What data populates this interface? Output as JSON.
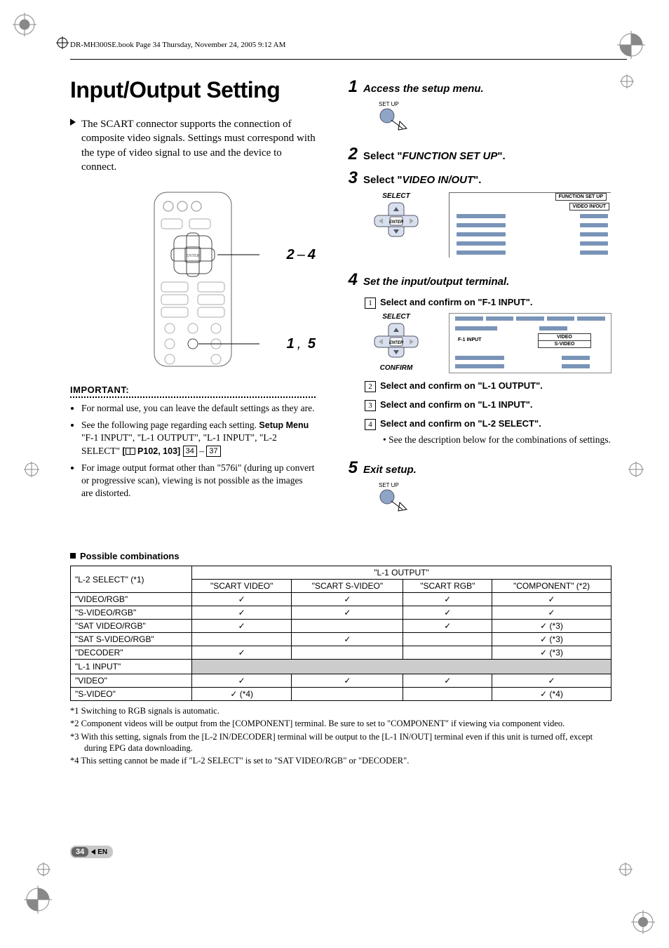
{
  "header": {
    "text": "DR-MH300SE.book  Page 34  Thursday, November 24, 2005  9:12 AM"
  },
  "title": "Input/Output Setting",
  "intro": "The SCART connector supports the connection of composite video signals. Settings must correspond with the type of video signal to use and the device to connect.",
  "remote_labels": {
    "group1": [
      "2",
      "4"
    ],
    "group2": [
      "1",
      "5"
    ]
  },
  "important": {
    "heading": "IMPORTANT:",
    "items": [
      {
        "text": "For normal use, you can leave the default settings as they are."
      },
      {
        "pre": "See the following page regarding each setting. ",
        "setup_menu": "Setup Menu",
        "menu_items": "\"F-1 INPUT\", \"L-1 OUTPUT\", \"L-1 INPUT\", \"L-2 SELECT\"",
        "pages": "P102, 103",
        "refs": [
          "34",
          "37"
        ]
      },
      {
        "text": "For image output format other than \"576i\" (during up convert or progressive scan), viewing is not possible as the images are distorted."
      }
    ]
  },
  "steps": {
    "s1": {
      "num": "1",
      "title": "Access the setup menu.",
      "btn_label": "SET UP"
    },
    "s2": {
      "num": "2",
      "pre": "Select \"",
      "bold": "FUNCTION SET UP",
      "post": "\"."
    },
    "s3": {
      "num": "3",
      "pre": "Select \"",
      "bold": "VIDEO IN/OUT",
      "post": "\"."
    },
    "select_graphic": {
      "select_label": "SELECT",
      "enter_label": "ENTER",
      "menu_tab_top": "FUNCTION SET UP",
      "menu_tab_sub": "VIDEO IN/OUT"
    },
    "s4": {
      "num": "4",
      "title": "Set the input/output terminal.",
      "sub1": {
        "n": "1",
        "text": "Select and confirm on \"F-1 INPUT\"."
      },
      "f1_graphic": {
        "select_label": "SELECT",
        "confirm_label": "CONFIRM",
        "f1_label": "F-1 INPUT",
        "opt1": "VIDEO",
        "opt2": "S-VIDEO"
      },
      "sub2": {
        "n": "2",
        "text": "Select and confirm on \"L-1 OUTPUT\"."
      },
      "sub3": {
        "n": "3",
        "text": "Select and confirm on \"L-1 INPUT\"."
      },
      "sub4": {
        "n": "4",
        "text": "Select and confirm on \"L-2 SELECT\"."
      },
      "sub4_desc": "See the description below for the combinations of settings."
    },
    "s5": {
      "num": "5",
      "title": "Exit setup.",
      "btn_label": "SET UP"
    }
  },
  "combinations": {
    "heading": "Possible combinations",
    "col_group": "\"L-1 OUTPUT\"",
    "row_group": "\"L-2 SELECT\" (*1)",
    "cols": [
      "\"SCART VIDEO\"",
      "\"SCART S-VIDEO\"",
      "\"SCART RGB\"",
      "\"COMPONENT\" (*2)"
    ],
    "rows": [
      {
        "label": "\"VIDEO/RGB\"",
        "cells": [
          "✓",
          "✓",
          "✓",
          "✓"
        ]
      },
      {
        "label": "\"S-VIDEO/RGB\"",
        "cells": [
          "✓",
          "✓",
          "✓",
          "✓"
        ]
      },
      {
        "label": "\"SAT VIDEO/RGB\"",
        "cells": [
          "✓",
          "",
          "✓",
          "✓ (*3)"
        ]
      },
      {
        "label": "\"SAT S-VIDEO/RGB\"",
        "cells": [
          "",
          "✓",
          "",
          "✓ (*3)"
        ]
      },
      {
        "label": "\"DECODER\"",
        "cells": [
          "✓",
          "",
          "",
          "✓ (*3)"
        ]
      }
    ],
    "section2_label": "\"L-1 INPUT\"",
    "rows2": [
      {
        "label": "\"VIDEO\"",
        "cells": [
          "✓",
          "✓",
          "✓",
          "✓"
        ]
      },
      {
        "label": "\"S-VIDEO\"",
        "cells": [
          "✓ (*4)",
          "",
          "",
          "✓ (*4)"
        ]
      }
    ],
    "footnotes": [
      "*1 Switching to RGB signals is automatic.",
      "*2 Component videos will be output from the [COMPONENT] terminal. Be sure to set to \"COMPONENT\" if viewing via component video.",
      "*3 With this setting, signals from the [L-2 IN/DECODER] terminal will be output to the [L-1 IN/OUT] terminal even if this unit is turned off, except during EPG data downloading.",
      "*4 This setting cannot be made if \"L-2 SELECT\" is set to \"SAT VIDEO/RGB\" or \"DECODER\"."
    ]
  },
  "footer": {
    "page_number": "34",
    "lang": "EN"
  }
}
